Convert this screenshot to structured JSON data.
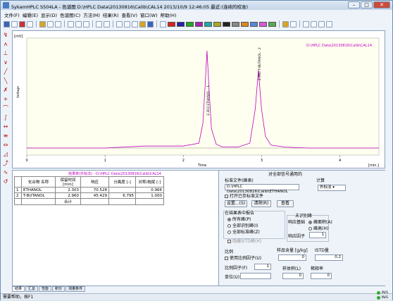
{
  "window": {
    "title": "SykamHPLC S504LA - 色谱图  D:\\HPLC Data\\20130816\\Calib\\CAL14   2013/10/9 12:46:05 最近:(连续的校准)"
  },
  "menu": [
    "文件(F)",
    "编辑(E)",
    "显示(D)",
    "色谱图(C)",
    "方法(M)",
    "结果(R)",
    "查看(V)",
    "窗口(W)",
    "帮助(H)"
  ],
  "chart": {
    "y_unit": "[mV]",
    "x_unit": "[min.]",
    "y_label": "Voltage",
    "x_label": "Time",
    "legend": "D:\\HPLC Data\\20130816\\Calib\\CAL14",
    "peak1_label": "2.303 ETHANOL - 1",
    "peak2_label": "2.960 T-BUTANOL - 2",
    "x_ticks": [
      "0",
      "1",
      "2",
      "3",
      "4"
    ]
  },
  "chart_data": {
    "type": "line",
    "xlim": [
      0,
      4.5
    ],
    "x": [
      0,
      0.5,
      1.0,
      1.5,
      2.0,
      2.2,
      2.25,
      2.28,
      2.303,
      2.33,
      2.36,
      2.42,
      2.5,
      2.7,
      2.85,
      2.92,
      2.96,
      3.0,
      3.05,
      3.12,
      3.3,
      3.6,
      4.0,
      4.5
    ],
    "y": [
      0,
      0,
      0,
      0.02,
      0.02,
      0.05,
      0.25,
      0.65,
      1.0,
      0.6,
      0.2,
      0.04,
      0.01,
      0.01,
      0.05,
      0.4,
      0.8,
      0.4,
      0.12,
      0.03,
      0.01,
      0,
      0,
      0
    ],
    "series": [
      {
        "name": "D:\\HPLC Data\\20130816\\Calib\\CAL14"
      }
    ]
  },
  "results": {
    "title": "结果表(外标法) - D:\\HPLC Data\\20130816\\Calib\\CAL14",
    "headers": [
      "",
      "化合物\n名称",
      "保留时间\n[min]",
      "响应",
      "分离度\n[-]",
      "对称/拖尾\n[-]"
    ],
    "rows": [
      [
        "1",
        "ETHANOL",
        "2.303",
        "70.528",
        "",
        "0.966"
      ],
      [
        "2",
        "T-BUTANOL",
        "2.960",
        "45.429",
        "6.795",
        "1.000"
      ],
      [
        "",
        "",
        "合计",
        "",
        "",
        ""
      ]
    ]
  },
  "panel": {
    "header": "对全部信号通用的",
    "std_file_label": "标准文件(峰表)",
    "std_file_value": "D:\\HPLC Data\\20130816\\Calib\\ETHANOL",
    "open_std_label": "打开已存标准文件",
    "btn_settings": "设置...(S)",
    "btn_clear": "清除(R)",
    "btn_view": "查看",
    "calc_label": "计算",
    "calc_value": "外标法",
    "report_label": "在结果表中报告",
    "opt_all_peaks": "所有峰(P)",
    "opt_all_identified": "全部识别峰(I)",
    "opt_all_std": "全部标准峰(Z)",
    "hide_istd": "隐藏ISTD峰(H)",
    "unid_label": "未识别峰",
    "resp_base": "响应基础",
    "opt_area": "峰面积(A)",
    "opt_height": "峰高(H)",
    "resp_factor": "响应因子",
    "resp_factor_value": "1",
    "ratio_label": "比例",
    "use_ratio": "使用比例因子(U)",
    "ratio_factor": "比例因子(F)",
    "ratio_value": "1",
    "unit_label": "单位(U)",
    "sample_label": "样品含量 [g/kg]",
    "sample_value": "0",
    "istd_label": "ISTD量",
    "istd_value": "0.2",
    "vol_label": "样体积(L)",
    "dilution_label": "稀释率",
    "vol_value": "0",
    "dilution_value": "0"
  },
  "tabs": [
    "结果",
    "汇总",
    "性能",
    "积分",
    "测量条件"
  ],
  "status": {
    "text": "需要帮助，按F1",
    "in1": "IN/S",
    "in2": "IN/S"
  }
}
